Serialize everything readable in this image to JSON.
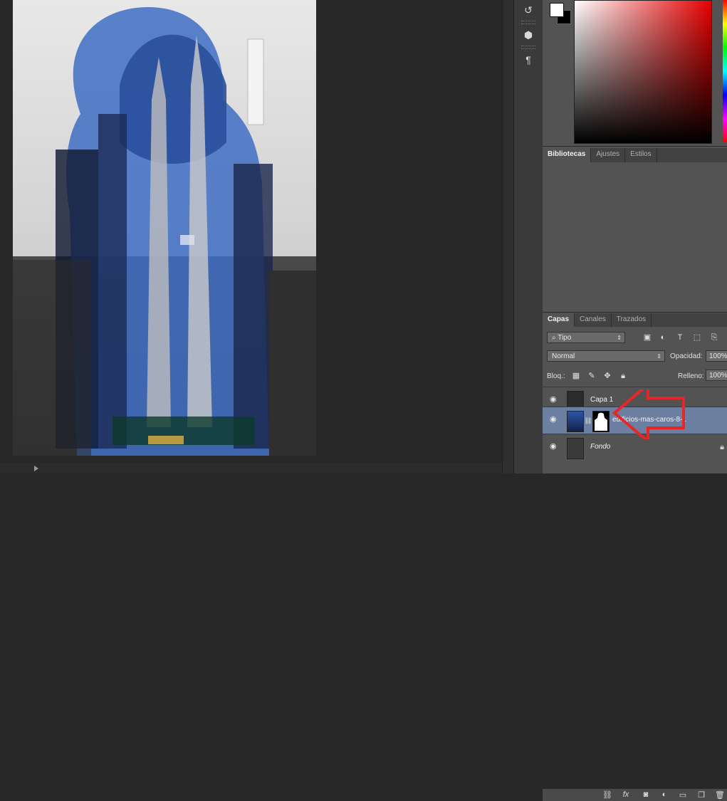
{
  "libraries_panel": {
    "tabs": [
      "Bibliotecas",
      "Ajustes",
      "Estilos"
    ]
  },
  "layers_panel": {
    "tabs": [
      "Capas",
      "Canales",
      "Trazados"
    ],
    "filter": "Tipo",
    "blend_mode": "Normal",
    "opacity_label": "Opacidad:",
    "opacity_value": "100%",
    "lock_label": "Bloq.:",
    "fill_label": "Relleno:",
    "fill_value": "100%",
    "layers": [
      {
        "name": "Capa 1",
        "selected": false
      },
      {
        "name": "edificios-mas-caros-8-1",
        "selected": true
      },
      {
        "name": "Fondo",
        "selected": false,
        "locked": true
      }
    ]
  },
  "annotation": {
    "arrow_color": "#e8262a"
  },
  "colors": {
    "accent": "#6d7fa1",
    "panel": "#535353",
    "canvas_bg": "#282828"
  }
}
